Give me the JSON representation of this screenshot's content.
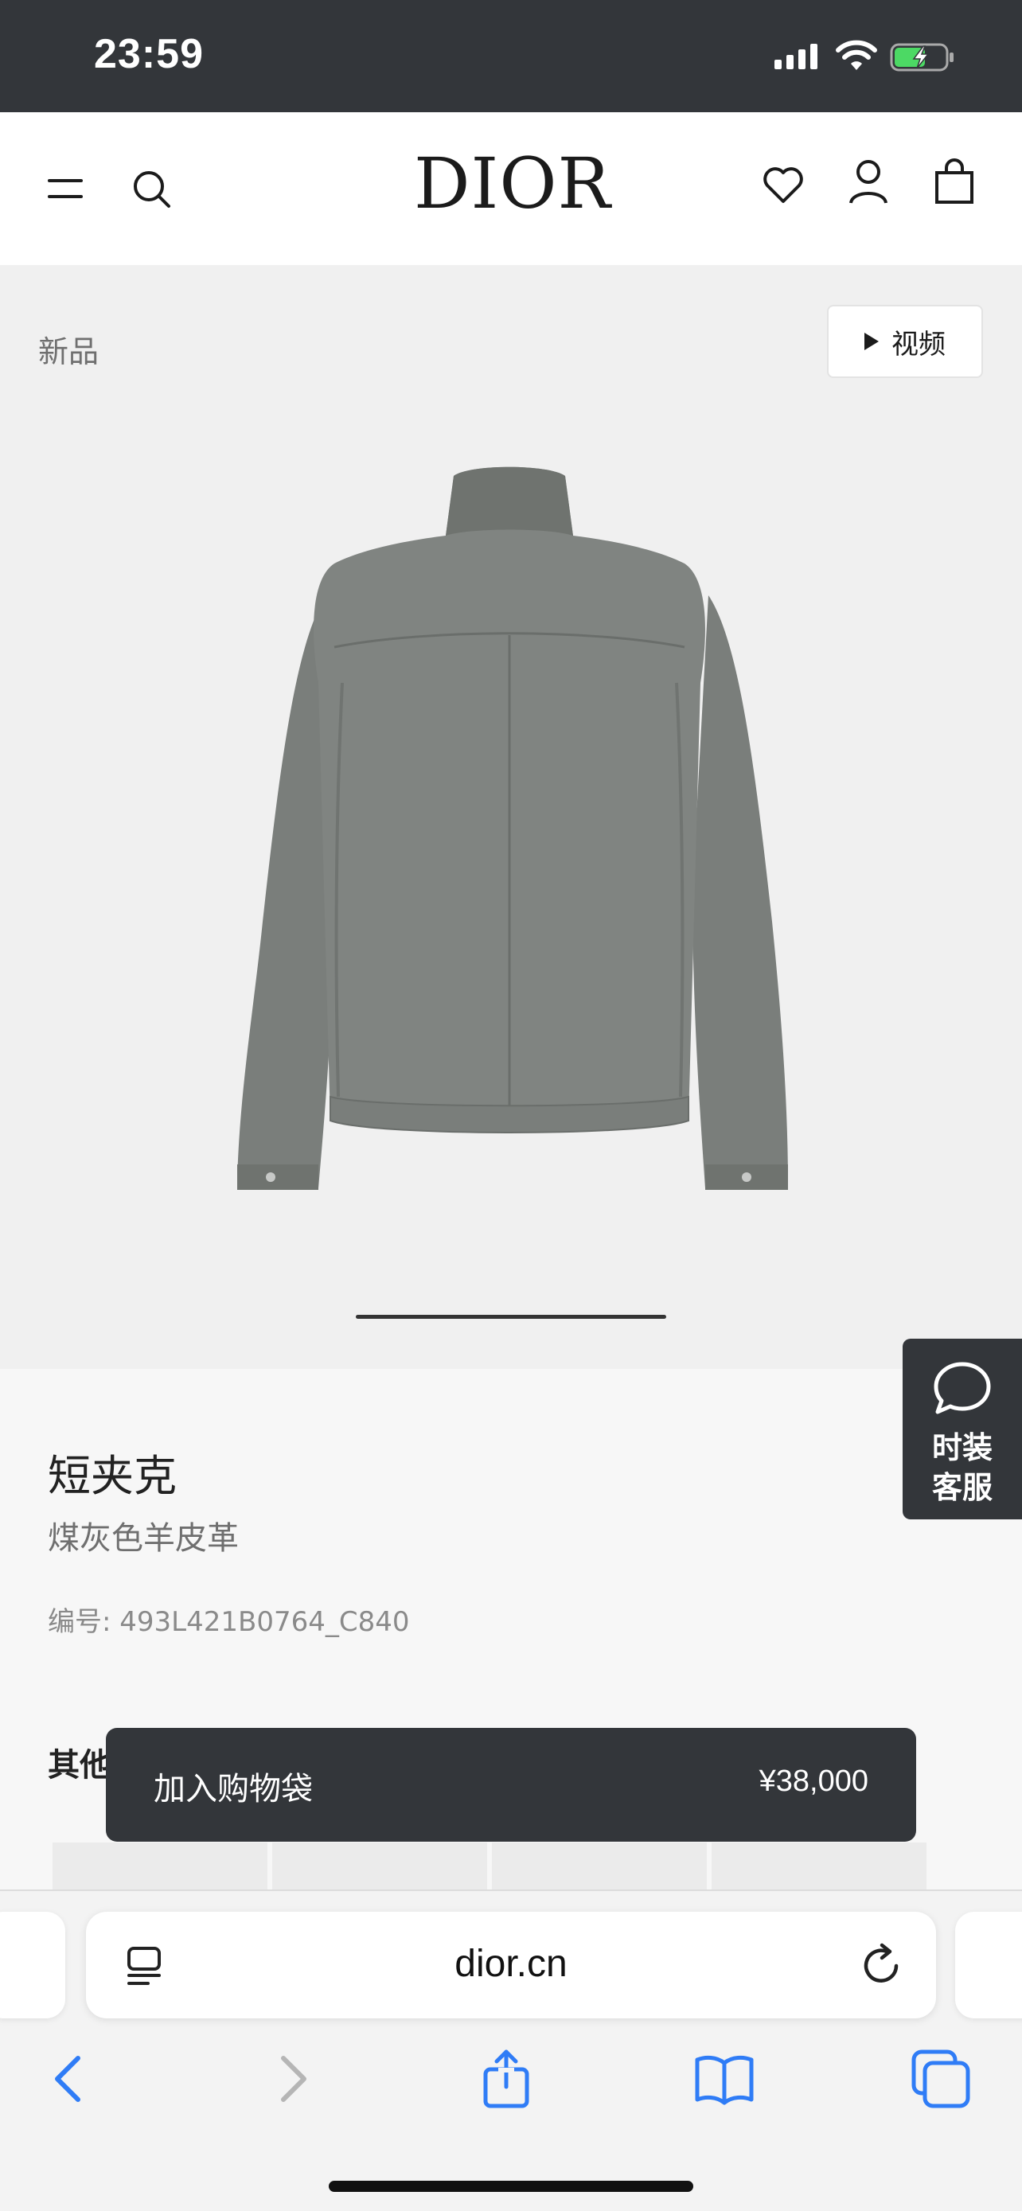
{
  "status_bar": {
    "time": "23:59",
    "icons": [
      "signal-icon",
      "wifi-icon",
      "battery-charging-icon"
    ]
  },
  "header": {
    "logo": "DIOR",
    "icons": [
      "menu-icon",
      "search-icon",
      "heart-icon",
      "account-icon",
      "shopping-bag-icon"
    ]
  },
  "gallery": {
    "tag": "新品",
    "video_button": "视频"
  },
  "chat": {
    "label_line1": "时装",
    "label_line2": "客服"
  },
  "product": {
    "name": "短夹克",
    "description": "煤灰色羊皮革",
    "reference": "编号: 493L421B0764_C840",
    "other_section": "其他"
  },
  "add_to_bag": {
    "label": "加入购物袋",
    "price": "¥38,000"
  },
  "safari": {
    "url": "dior.cn",
    "toolbar": [
      "back-icon",
      "forward-icon",
      "share-icon",
      "bookmarks-icon",
      "tabs-icon"
    ]
  },
  "colors": {
    "dark": "#33363a",
    "accent_blue": "#2f7cf6",
    "battery_green": "#4cd964",
    "jacket_gray": "#7c807d"
  }
}
